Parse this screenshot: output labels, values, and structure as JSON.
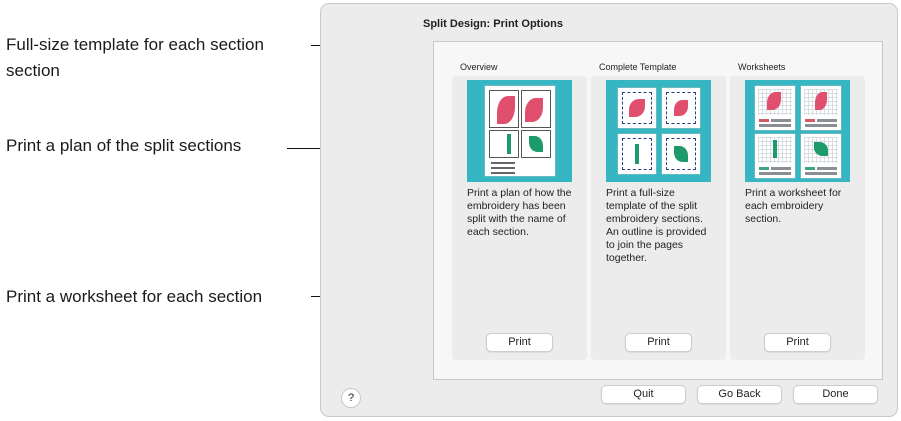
{
  "callouts": {
    "template_line1": "Full-size template for each section",
    "template_line2": "section",
    "plan": "Print a plan of the split sections",
    "worksheet": "Print a worksheet for each section"
  },
  "dialog": {
    "title": "Split Design: Print Options",
    "columns": [
      {
        "label": "Overview",
        "description": "Print a plan of how the embroidery has been split with the name of each section.",
        "button": "Print",
        "icon": "overview-thumbnail"
      },
      {
        "label": "Complete Template",
        "description": "Print a full-size template of the split embroidery sections. An outline is provided to join the pages together.",
        "button": "Print",
        "icon": "template-thumbnail"
      },
      {
        "label": "Worksheets",
        "description": "Print a worksheet for each embroidery section.",
        "button": "Print",
        "icon": "worksheet-thumbnail"
      }
    ],
    "help_label": "?",
    "buttons": {
      "quit": "Quit",
      "go_back": "Go Back",
      "done": "Done"
    }
  },
  "colors": {
    "thumbnail_bg": "#36b5c3",
    "petal_pink": "#e0506e",
    "leaf_green": "#1e9a6a"
  }
}
